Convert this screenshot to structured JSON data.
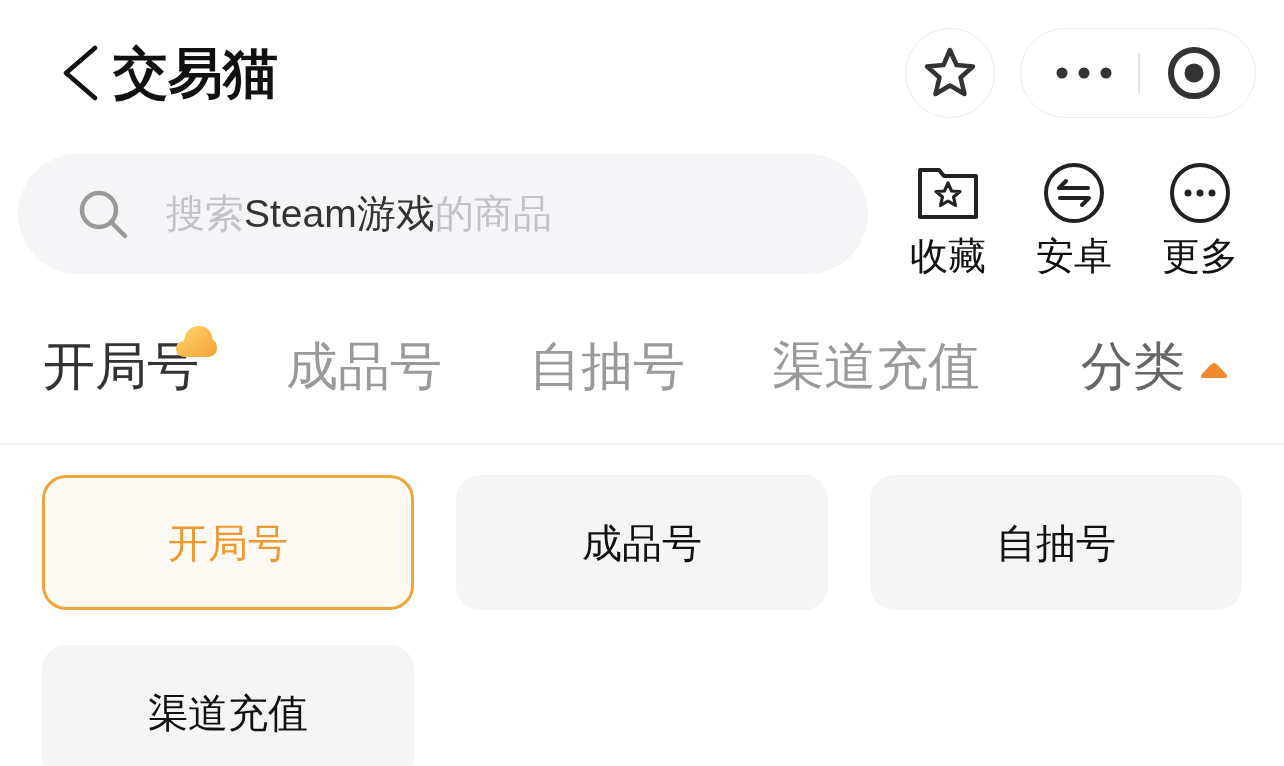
{
  "nav_bar": {
    "title": "交易猫"
  },
  "search": {
    "placeholder_segments": [
      {
        "text": "搜索",
        "emphasis": false
      },
      {
        "text": "Steam游戏",
        "emphasis": true
      },
      {
        "text": "的商品",
        "emphasis": false
      }
    ]
  },
  "shortcuts": [
    {
      "label": "收藏",
      "kind": "favorites"
    },
    {
      "label": "安卓",
      "kind": "platform"
    },
    {
      "label": "更多",
      "kind": "more"
    }
  ],
  "tabs": [
    {
      "label": "开局号",
      "selected": true,
      "badge": true
    },
    {
      "label": "成品号",
      "selected": false,
      "badge": false
    },
    {
      "label": "自抽号",
      "selected": false,
      "badge": false
    },
    {
      "label": "渠道充值",
      "selected": false,
      "badge": false
    }
  ],
  "category_toggle": {
    "label": "分类",
    "expanded": true
  },
  "categories": [
    {
      "label": "开局号",
      "selected": true
    },
    {
      "label": "成品号",
      "selected": false
    },
    {
      "label": "自抽号",
      "selected": false
    },
    {
      "label": "渠道充值",
      "selected": false
    }
  ]
}
